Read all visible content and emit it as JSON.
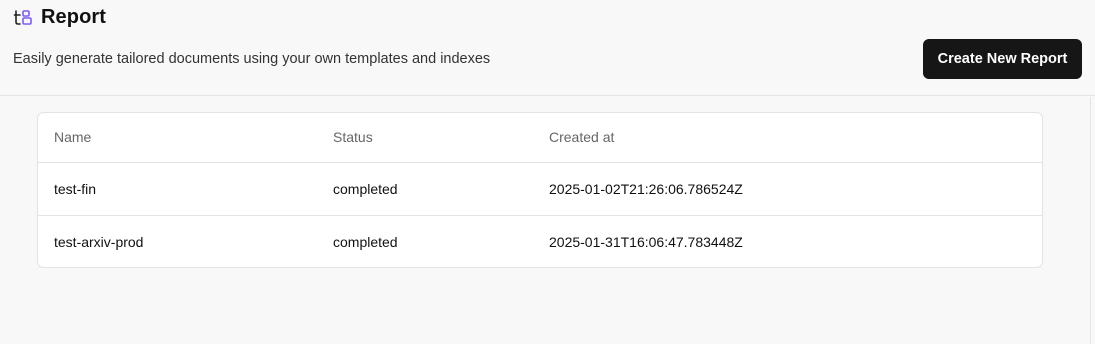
{
  "header": {
    "title": "Report",
    "subtitle": "Easily generate tailored documents using your own templates and indexes",
    "create_button_label": "Create New Report"
  },
  "table": {
    "columns": [
      "Name",
      "Status",
      "Created at"
    ],
    "rows": [
      {
        "name": "test-fin",
        "status": "completed",
        "created_at": "2025-01-02T21:26:06.786524Z"
      },
      {
        "name": "test-arxiv-prod",
        "status": "completed",
        "created_at": "2025-01-31T16:06:47.783448Z"
      }
    ]
  },
  "icons": {
    "logo": "report-logo-icon"
  },
  "colors": {
    "background": "#f8f8f8",
    "primary_button": "#161616",
    "logo_accent": "#7c5cf5"
  }
}
